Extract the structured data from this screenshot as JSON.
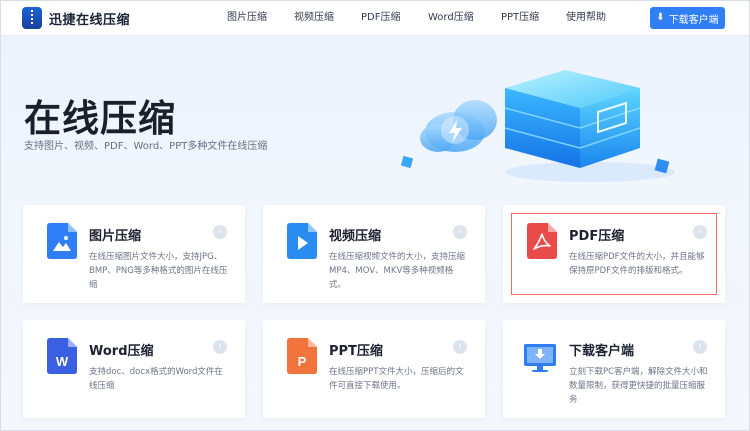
{
  "header": {
    "logo_text": "迅捷在线压缩",
    "nav": [
      "图片压缩",
      "视频压缩",
      "PDF压缩",
      "Word压缩",
      "PPT压缩",
      "使用帮助"
    ],
    "download_button": "下载客户端"
  },
  "hero": {
    "title": "在线压缩",
    "subtitle": "支持图片、视频、PDF、Word、PPT多种文件在线压缩"
  },
  "cards": [
    {
      "title": "图片压缩",
      "desc": "在线压缩图片文件大小，支持JPG、BMP、PNG等多种格式的图片在线压缩",
      "icon": "image-file-icon",
      "color": "#2f7ef5"
    },
    {
      "title": "视频压缩",
      "desc": "在线压缩视频文件的大小，支持压缩MP4、MOV、MKV等多种视频格式。",
      "icon": "video-file-icon",
      "color": "#2a8cf0"
    },
    {
      "title": "PDF压缩",
      "desc": "在线压缩PDF文件的大小，并且能够保持原PDF文件的排版和格式。",
      "icon": "pdf-file-icon",
      "color": "#e94b4b",
      "selected": true
    },
    {
      "title": "Word压缩",
      "desc": "支持doc、docx格式的Word文件在线压缩",
      "icon": "word-file-icon",
      "color": "#3a5fe0"
    },
    {
      "title": "PPT压缩",
      "desc": "在线压缩PPT文件大小，压缩后的文件可直接下载使用。",
      "icon": "ppt-file-icon",
      "color": "#f0743c"
    },
    {
      "title": "下载客户端",
      "desc": "立刻下载PC客户端，解除文件大小和数量限制，获得更快捷的批量压缩服务",
      "icon": "monitor-download-icon",
      "color": "#2f7ef5"
    }
  ]
}
